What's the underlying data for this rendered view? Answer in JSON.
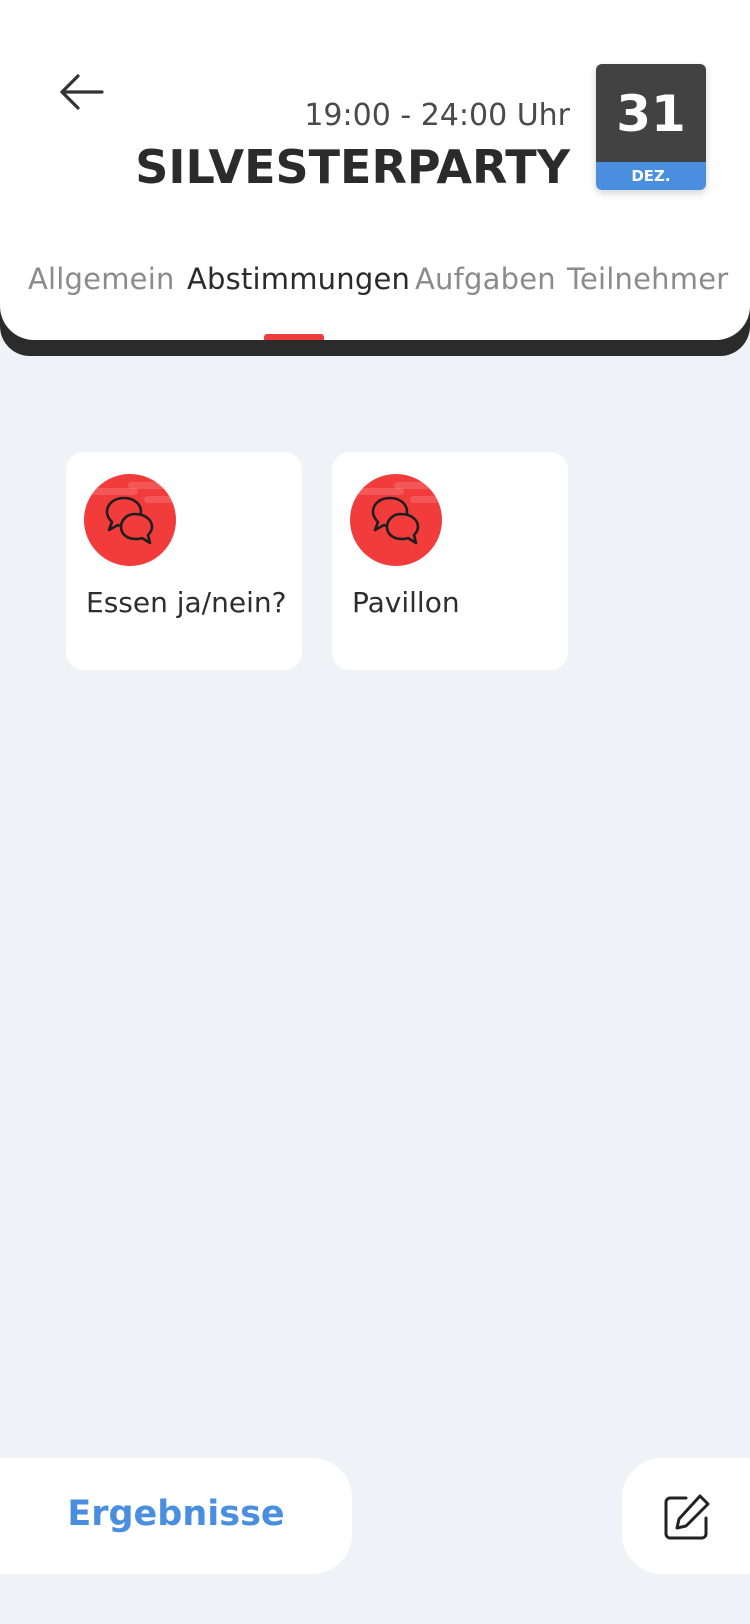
{
  "header": {
    "time": "19:00 - 24:00 Uhr",
    "title": "SILVESTERPARTY",
    "date": {
      "day": "31",
      "month": "DEZ."
    },
    "back_icon": "arrow-left-icon"
  },
  "tabs": [
    {
      "label": "Allgemein",
      "active": false
    },
    {
      "label": "Abstimmungen",
      "active": true
    },
    {
      "label": "Aufgaben",
      "active": false
    },
    {
      "label": "Teilnehmer",
      "active": false
    }
  ],
  "polls": [
    {
      "label": "Essen ja/nein?",
      "icon": "chat-bubbles-icon"
    },
    {
      "label": "Pavillon",
      "icon": "chat-bubbles-icon"
    }
  ],
  "bottom": {
    "results_label": "Ergebnisse",
    "edit_icon": "edit-icon"
  },
  "colors": {
    "accent": "#ef3b3b",
    "link_blue": "#4a8ee0",
    "background": "#f1f2f7",
    "date_dark": "#424242"
  }
}
